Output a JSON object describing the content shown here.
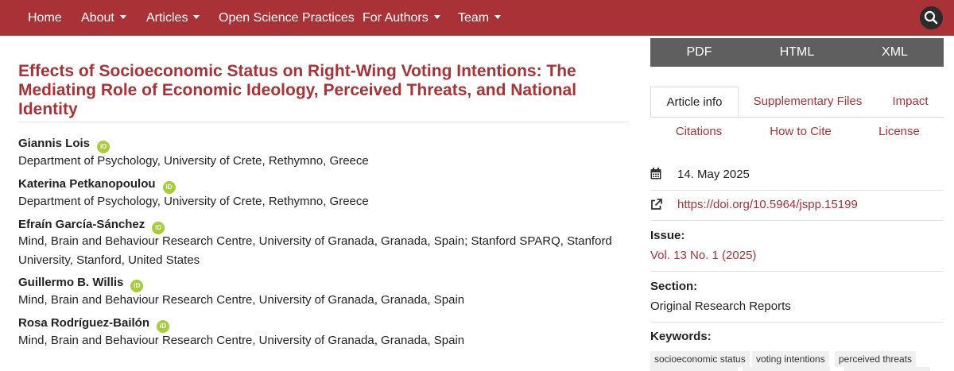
{
  "nav": {
    "home": "Home",
    "about": "About",
    "articles": "Articles",
    "open_science": "Open Science Practices",
    "for_authors": "For Authors",
    "team": "Team"
  },
  "article": {
    "title": "Effects of Socioeconomic Status on Right-Wing Voting Intentions: The Mediating Role of Economic Ideology, Perceived Threats, and National Identity",
    "authors": [
      {
        "name": "Giannis Lois",
        "affiliation": "Department of Psychology, University of Crete, Rethymno, Greece"
      },
      {
        "name": "Katerina Petkanopoulou",
        "affiliation": "Department of Psychology, University of Crete, Rethymno, Greece"
      },
      {
        "name": "Efraín García-Sánchez",
        "affiliation": "Mind, Brain and Behaviour Research Centre, University of Granada, Granada, Spain; Stanford SPARQ, Stanford University, Stanford, United States"
      },
      {
        "name": "Guillermo B. Willis",
        "affiliation": "Mind, Brain and Behaviour Research Centre, University of Granada, Granada, Spain"
      },
      {
        "name": "Rosa Rodríguez-Bailón",
        "affiliation": "Mind, Brain and Behaviour Research Centre, University of Granada, Granada, Spain"
      }
    ],
    "orcid_icon": "iD"
  },
  "sidebar": {
    "galleys": {
      "pdf": "PDF",
      "html": "HTML",
      "xml": "XML"
    },
    "tabs": {
      "article_info": "Article info",
      "supplementary": "Supplementary Files",
      "impact": "Impact",
      "citations": "Citations",
      "how_to_cite": "How to Cite",
      "license": "License"
    },
    "published_date": "14. May 2025",
    "doi": "https://doi.org/10.5964/jspp.15199",
    "issue_label": "Issue:",
    "issue_value": "Vol. 13 No. 1 (2025)",
    "section_label": "Section:",
    "section_value": "Original Research Reports",
    "keywords_label": "Keywords:",
    "keywords": [
      "socioeconomic status",
      "voting intentions",
      "perceived threats"
    ]
  },
  "colors": {
    "brand": "#a83236",
    "galley_bar": "#5f5f5f",
    "orcid": "#a6ce39"
  },
  "icons": {
    "search": "search-icon",
    "calendar": "calendar-icon",
    "external_link": "external-link-icon",
    "caret": "caret-down-icon"
  }
}
